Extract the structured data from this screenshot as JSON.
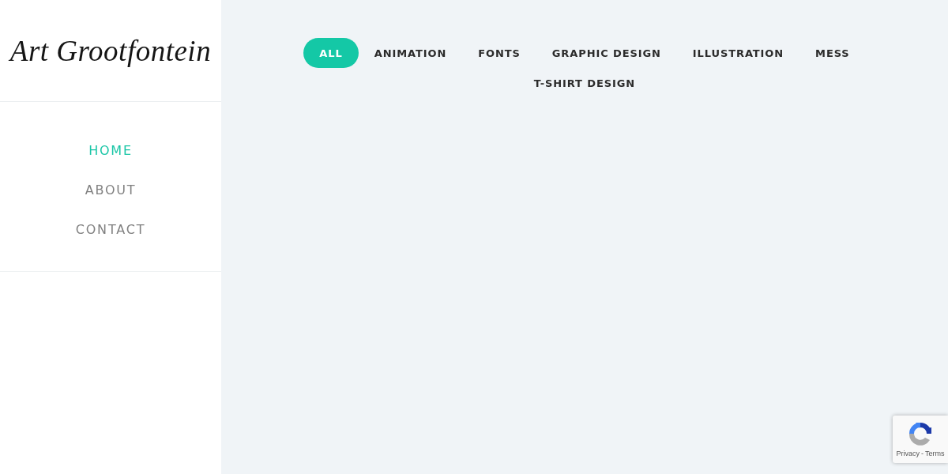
{
  "logo": {
    "text": "Art Grootfontein"
  },
  "nav": [
    {
      "label": "HOME",
      "selected": true
    },
    {
      "label": "ABOUT",
      "selected": false
    },
    {
      "label": "CONTACT",
      "selected": false
    }
  ],
  "filters": [
    {
      "label": "ALL",
      "selected": true
    },
    {
      "label": "ANIMATION",
      "selected": false
    },
    {
      "label": "FONTS",
      "selected": false
    },
    {
      "label": "GRAPHIC DESIGN",
      "selected": false
    },
    {
      "label": "ILLUSTRATION",
      "selected": false
    },
    {
      "label": "MESS",
      "selected": false
    },
    {
      "label": "T-SHIRT DESIGN",
      "selected": false
    }
  ],
  "recaptcha": {
    "privacy": "Privacy",
    "separator": "-",
    "terms": "Terms"
  }
}
